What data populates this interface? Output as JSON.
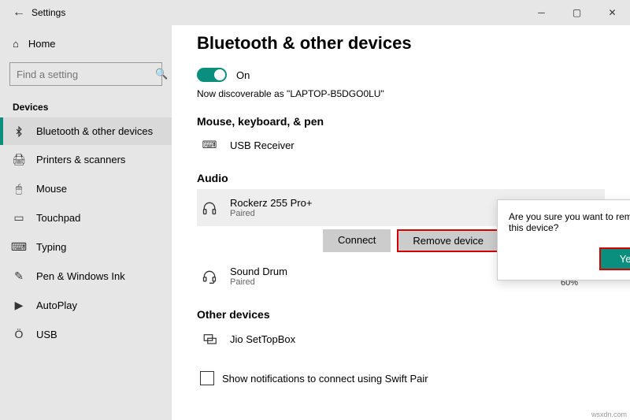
{
  "window": {
    "title": "Settings"
  },
  "sidebar": {
    "home": "Home",
    "search_placeholder": "Find a setting",
    "section": "Devices",
    "items": [
      {
        "label": "Bluetooth & other devices"
      },
      {
        "label": "Printers & scanners"
      },
      {
        "label": "Mouse"
      },
      {
        "label": "Touchpad"
      },
      {
        "label": "Typing"
      },
      {
        "label": "Pen & Windows Ink"
      },
      {
        "label": "AutoPlay"
      },
      {
        "label": "USB"
      }
    ]
  },
  "page": {
    "title": "Bluetooth & other devices",
    "toggle_state": "On",
    "discoverable": "Now discoverable as \"LAPTOP-B5DGO0LU\"",
    "sections": {
      "mkp": {
        "heading": "Mouse, keyboard, & pen",
        "dev1": "USB Receiver"
      },
      "audio": {
        "heading": "Audio",
        "dev1": {
          "name": "Rockerz 255 Pro+",
          "status": "Paired"
        },
        "dev2": {
          "name": "Sound Drum",
          "status": "Paired",
          "battery": "60%"
        }
      },
      "other": {
        "heading": "Other devices",
        "dev1": "Jio SetTopBox"
      }
    },
    "buttons": {
      "connect": "Connect",
      "remove": "Remove device"
    },
    "swift_pair": "Show notifications to connect using Swift Pair"
  },
  "dialog": {
    "text": "Are you sure you want to remove this device?",
    "yes": "Yes"
  },
  "colors": {
    "accent": "#0a8f7e",
    "highlight": "#d40000"
  }
}
